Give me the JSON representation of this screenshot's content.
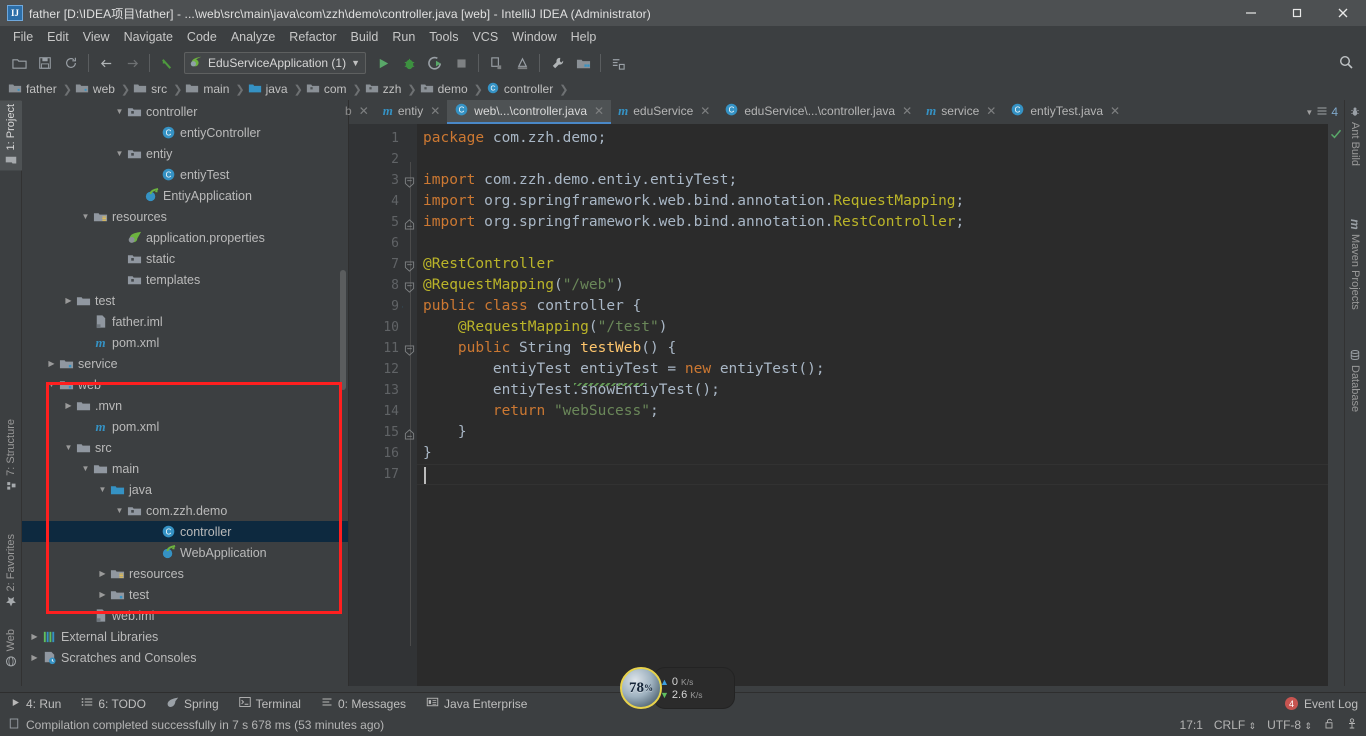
{
  "window": {
    "title": "father [D:\\IDEA项目\\father] - ...\\web\\src\\main\\java\\com\\zzh\\demo\\controller.java [web] - IntelliJ IDEA (Administrator)",
    "app_badge": "IJ",
    "minimize": "minimize-button",
    "maximize": "maximize-button",
    "close": "close-button"
  },
  "menu": [
    {
      "label": "File"
    },
    {
      "label": "Edit"
    },
    {
      "label": "View"
    },
    {
      "label": "Navigate"
    },
    {
      "label": "Code"
    },
    {
      "label": "Analyze"
    },
    {
      "label": "Refactor"
    },
    {
      "label": "Build"
    },
    {
      "label": "Run"
    },
    {
      "label": "Tools"
    },
    {
      "label": "VCS"
    },
    {
      "label": "Window"
    },
    {
      "label": "Help"
    }
  ],
  "toolbar": {
    "run_config": "EduServiceApplication (1)",
    "icons": [
      "open-folder-icon",
      "save-all-icon",
      "sync-icon",
      "back-arrow-icon",
      "forward-arrow-icon",
      "undo-icon",
      "run-icon",
      "debug-icon",
      "run-coverage-icon",
      "stop-icon",
      "build-project-icon",
      "build-module-icon",
      "settings-wrench-icon",
      "project-structure-icon",
      "update-project-icon",
      "search-everywhere-icon"
    ]
  },
  "breadcrumb": [
    {
      "label": "father",
      "icon": "module-icon"
    },
    {
      "label": "web",
      "icon": "module-icon"
    },
    {
      "label": "src",
      "icon": "folder-icon"
    },
    {
      "label": "main",
      "icon": "folder-icon"
    },
    {
      "label": "java",
      "icon": "source-folder-icon"
    },
    {
      "label": "com",
      "icon": "package-icon"
    },
    {
      "label": "zzh",
      "icon": "package-icon"
    },
    {
      "label": "demo",
      "icon": "package-icon"
    },
    {
      "label": "controller",
      "icon": "class-icon"
    }
  ],
  "left_tool_tabs": [
    {
      "label": "1: Project",
      "key": "1",
      "icon": "project-icon",
      "active": true
    },
    {
      "label": "7: Structure",
      "key": "7",
      "icon": "structure-icon",
      "active": false
    },
    {
      "label": "2: Favorites",
      "key": "2",
      "icon": "star-icon",
      "active": false
    },
    {
      "label": "Web",
      "key": "",
      "icon": "web-icon",
      "active": false
    }
  ],
  "right_tool_tabs": [
    {
      "label": "Ant Build",
      "icon": "ant-icon"
    },
    {
      "label": "Maven Projects",
      "icon": "maven-icon"
    },
    {
      "label": "Database",
      "icon": "database-icon"
    }
  ],
  "project_panel": {
    "title": "Project",
    "header_icons": [
      "locate-icon",
      "collapse-all-icon",
      "gear-icon",
      "hide-icon"
    ],
    "tree": [
      {
        "label": "controller",
        "indent": 5,
        "arrow": "down",
        "icon": "package-icon",
        "selected": false
      },
      {
        "label": "entiyController",
        "indent": 7,
        "arrow": "none",
        "icon": "class-icon",
        "selected": false
      },
      {
        "label": "entiy",
        "indent": 5,
        "arrow": "down",
        "icon": "package-icon",
        "selected": false
      },
      {
        "label": "entiyTest",
        "indent": 7,
        "arrow": "none",
        "icon": "class-icon",
        "selected": false
      },
      {
        "label": "EntiyApplication",
        "indent": 6,
        "arrow": "none",
        "icon": "spring-class-icon",
        "selected": false
      },
      {
        "label": "resources",
        "indent": 3,
        "arrow": "down",
        "icon": "resource-folder-icon",
        "selected": false
      },
      {
        "label": "application.properties",
        "indent": 5,
        "arrow": "none",
        "icon": "spring-props-icon",
        "selected": false
      },
      {
        "label": "static",
        "indent": 5,
        "arrow": "none",
        "icon": "package-icon",
        "selected": false
      },
      {
        "label": "templates",
        "indent": 5,
        "arrow": "none",
        "icon": "package-icon",
        "selected": false
      },
      {
        "label": "test",
        "indent": 2,
        "arrow": "right",
        "icon": "folder-icon",
        "selected": false
      },
      {
        "label": "father.iml",
        "indent": 3,
        "arrow": "none",
        "icon": "iml-icon",
        "selected": false
      },
      {
        "label": "pom.xml",
        "indent": 3,
        "arrow": "none",
        "icon": "maven-file-icon",
        "selected": false
      },
      {
        "label": "service",
        "indent": 1,
        "arrow": "right",
        "icon": "module-icon",
        "selected": false
      },
      {
        "label": "web",
        "indent": 1,
        "arrow": "down",
        "icon": "module-icon",
        "selected": false
      },
      {
        "label": ".mvn",
        "indent": 2,
        "arrow": "right",
        "icon": "folder-icon",
        "selected": false
      },
      {
        "label": "pom.xml",
        "indent": 3,
        "arrow": "none",
        "icon": "maven-file-icon",
        "selected": false
      },
      {
        "label": "src",
        "indent": 2,
        "arrow": "down",
        "icon": "folder-icon",
        "selected": false
      },
      {
        "label": "main",
        "indent": 3,
        "arrow": "down",
        "icon": "folder-icon",
        "selected": false
      },
      {
        "label": "java",
        "indent": 4,
        "arrow": "down",
        "icon": "source-folder-icon",
        "selected": false
      },
      {
        "label": "com.zzh.demo",
        "indent": 5,
        "arrow": "down",
        "icon": "package-icon",
        "selected": false
      },
      {
        "label": "controller",
        "indent": 7,
        "arrow": "none",
        "icon": "class-icon",
        "selected": true
      },
      {
        "label": "WebApplication",
        "indent": 7,
        "arrow": "none",
        "icon": "spring-class-icon",
        "selected": false
      },
      {
        "label": "resources",
        "indent": 4,
        "arrow": "right",
        "icon": "resource-folder-icon",
        "selected": false
      },
      {
        "label": "test",
        "indent": 4,
        "arrow": "right",
        "icon": "module-icon",
        "selected": false
      },
      {
        "label": "web.iml",
        "indent": 3,
        "arrow": "none",
        "icon": "iml-icon",
        "selected": false
      },
      {
        "label": "External Libraries",
        "indent": 0,
        "arrow": "right",
        "icon": "libraries-icon",
        "selected": false
      },
      {
        "label": "Scratches and Consoles",
        "indent": 0,
        "arrow": "right",
        "icon": "scratches-icon",
        "selected": false
      }
    ]
  },
  "editor_tabs": [
    {
      "label": "b",
      "icon": "file-icon",
      "active": false,
      "partial": true
    },
    {
      "label": "entiy",
      "icon": "maven-file-icon",
      "active": false
    },
    {
      "label": "web\\...\\controller.java",
      "icon": "class-icon",
      "active": true
    },
    {
      "label": "eduService",
      "icon": "maven-file-icon",
      "active": false
    },
    {
      "label": "eduService\\...\\controller.java",
      "icon": "class-icon",
      "active": false
    },
    {
      "label": "service",
      "icon": "maven-file-icon",
      "active": false
    },
    {
      "label": "entiyTest.java",
      "icon": "class-icon",
      "active": false
    }
  ],
  "tabs_right": {
    "count": "4",
    "icon": "tab-list-icon"
  },
  "code": {
    "line_numbers": [
      "1",
      "2",
      "3",
      "4",
      "5",
      "6",
      "7",
      "8",
      "9",
      "10",
      "11",
      "12",
      "13",
      "14",
      "15",
      "16",
      "17"
    ],
    "lines": [
      [
        {
          "t": "package ",
          "c": "kw"
        },
        {
          "t": "com.zzh.demo",
          "c": "txt"
        },
        {
          "t": ";",
          "c": "txt"
        }
      ],
      [],
      [
        {
          "t": "import ",
          "c": "kw"
        },
        {
          "t": "com.zzh.demo.entiy.entiyTest",
          "c": "txt"
        },
        {
          "t": ";",
          "c": "txt"
        }
      ],
      [
        {
          "t": "import ",
          "c": "kw"
        },
        {
          "t": "org.springframework.web.bind.annotation.",
          "c": "txt"
        },
        {
          "t": "RequestMapping",
          "c": "ann"
        },
        {
          "t": ";",
          "c": "txt"
        }
      ],
      [
        {
          "t": "import ",
          "c": "kw"
        },
        {
          "t": "org.springframework.web.bind.annotation.",
          "c": "txt"
        },
        {
          "t": "RestController",
          "c": "ann"
        },
        {
          "t": ";",
          "c": "txt"
        }
      ],
      [],
      [
        {
          "t": "@RestController",
          "c": "ann"
        }
      ],
      [
        {
          "t": "@RequestMapping",
          "c": "ann"
        },
        {
          "t": "(",
          "c": "txt"
        },
        {
          "t": "\"/web\"",
          "c": "str"
        },
        {
          "t": ")",
          "c": "txt"
        }
      ],
      [
        {
          "t": "public ",
          "c": "kw"
        },
        {
          "t": "class ",
          "c": "kw"
        },
        {
          "t": "controller ",
          "c": "txt"
        },
        {
          "t": "{",
          "c": "txt"
        }
      ],
      [
        {
          "t": "    @RequestMapping",
          "c": "ann"
        },
        {
          "t": "(",
          "c": "txt"
        },
        {
          "t": "\"/test\"",
          "c": "str"
        },
        {
          "t": ")",
          "c": "txt"
        }
      ],
      [
        {
          "t": "    ",
          "c": "txt"
        },
        {
          "t": "public ",
          "c": "kw"
        },
        {
          "t": "String ",
          "c": "txt"
        },
        {
          "t": "testWeb",
          "c": "meth"
        },
        {
          "t": "() {",
          "c": "txt"
        }
      ],
      [
        {
          "t": "        entiyTest entiyTest = ",
          "c": "txt"
        },
        {
          "t": "new ",
          "c": "kw"
        },
        {
          "t": "entiyTest();",
          "c": "txt"
        }
      ],
      [
        {
          "t": "        entiyTest.showEntiyTest();",
          "c": "txt"
        }
      ],
      [
        {
          "t": "        ",
          "c": "txt"
        },
        {
          "t": "return ",
          "c": "kw"
        },
        {
          "t": "\"webSucess\"",
          "c": "str"
        },
        {
          "t": ";",
          "c": "txt"
        }
      ],
      [
        {
          "t": "    }",
          "c": "txt"
        }
      ],
      [
        {
          "t": "}",
          "c": "txt"
        }
      ],
      []
    ],
    "gutter_marks": [
      {
        "line": 9,
        "icon": "spring-bean-icon"
      }
    ],
    "folds": [
      {
        "line": 3,
        "type": "start"
      },
      {
        "line": 5,
        "type": "end"
      },
      {
        "line": 7,
        "type": "start"
      },
      {
        "line": 8,
        "type": "start"
      },
      {
        "line": 11,
        "type": "start"
      },
      {
        "line": 15,
        "type": "end"
      }
    ],
    "inspection_status": "ok-check-icon"
  },
  "bottom_tool_tabs": [
    {
      "label": "4: Run",
      "key": "4",
      "icon": "run-icon"
    },
    {
      "label": "6: TODO",
      "key": "6",
      "icon": "todo-icon"
    },
    {
      "label": "Spring",
      "key": "",
      "icon": "spring-leaf-icon"
    },
    {
      "label": "Terminal",
      "key": "",
      "icon": "terminal-icon"
    },
    {
      "label": "0: Messages",
      "key": "0",
      "icon": "messages-icon"
    },
    {
      "label": "Java Enterprise",
      "key": "",
      "icon": "java-enterprise-icon"
    }
  ],
  "event_log": {
    "label": "Event Log",
    "badge": "4"
  },
  "status": {
    "message": "Compilation completed successfully in 7 s 678 ms (53 minutes ago)",
    "message_icon": "document-icon",
    "caret_position": "17:1",
    "line_separator": "CRLF",
    "encoding": "UTF-8",
    "lock_icon": "unlocked-icon",
    "inspection_icon": "inspector-icon"
  },
  "network_widget": {
    "upload": "0",
    "upload_unit": "K/s",
    "download": "2.6",
    "download_unit": "K/s",
    "percent": "78",
    "percent_symbol": "%"
  },
  "colors": {
    "chrome": "#3C3F41",
    "titlebar": "#4D5052",
    "editor_bg": "#2B2B2B",
    "gutter_bg": "#313335",
    "selection": "#0D293F",
    "accent_blue": "#4A88C7",
    "highlight_red": "#FF1F1F",
    "keyword": "#CC7832",
    "annotation": "#BBB529",
    "string": "#6A8759",
    "method": "#FFC66D",
    "text": "#A9B7C6"
  }
}
